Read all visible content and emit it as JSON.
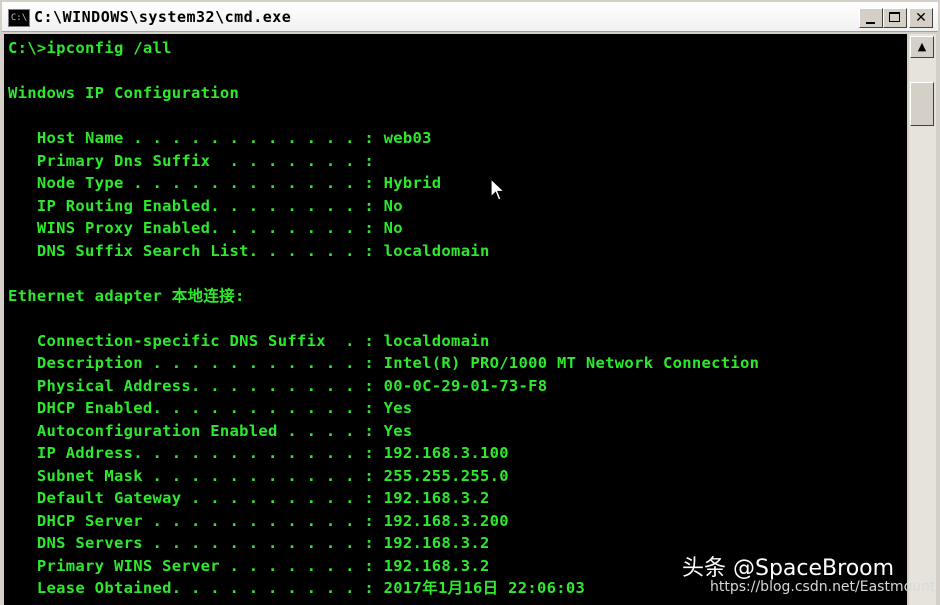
{
  "window": {
    "title": "C:\\WINDOWS\\system32\\cmd.exe",
    "icon": "cmd-icon",
    "icon_text": "C:\\"
  },
  "controls": {
    "minimize_icon": "minimize-icon",
    "maximize_icon": "maximize-icon",
    "close_label": "✕"
  },
  "console": {
    "text_color": "#2ee82e",
    "background": "#000000",
    "lines": [
      "C:\\>ipconfig /all",
      "",
      "Windows IP Configuration",
      "",
      "   Host Name . . . . . . . . . . . . : web03",
      "   Primary Dns Suffix  . . . . . . . :",
      "   Node Type . . . . . . . . . . . . : Hybrid",
      "   IP Routing Enabled. . . . . . . . : No",
      "   WINS Proxy Enabled. . . . . . . . : No",
      "   DNS Suffix Search List. . . . . . : localdomain",
      "",
      "Ethernet adapter 本地连接:",
      "",
      "   Connection-specific DNS Suffix  . : localdomain",
      "   Description . . . . . . . . . . . : Intel(R) PRO/1000 MT Network Connection",
      "   Physical Address. . . . . . . . . : 00-0C-29-01-73-F8",
      "   DHCP Enabled. . . . . . . . . . . : Yes",
      "   Autoconfiguration Enabled . . . . : Yes",
      "   IP Address. . . . . . . . . . . . : 192.168.3.100",
      "   Subnet Mask . . . . . . . . . . . : 255.255.255.0",
      "   Default Gateway . . . . . . . . . : 192.168.3.2",
      "   DHCP Server . . . . . . . . . . . : 192.168.3.200",
      "   DNS Servers . . . . . . . . . . . : 192.168.3.2",
      "   Primary WINS Server . . . . . . . : 192.168.3.2",
      "   Lease Obtained. . . . . . . . . . : 2017年1月16日 22:06:03"
    ]
  },
  "scrollbar": {
    "up_icon": "▲",
    "position": 0.08
  },
  "watermark": {
    "text": "头条 @SpaceBroom",
    "url": "https://blog.csdn.net/Eastmount"
  }
}
